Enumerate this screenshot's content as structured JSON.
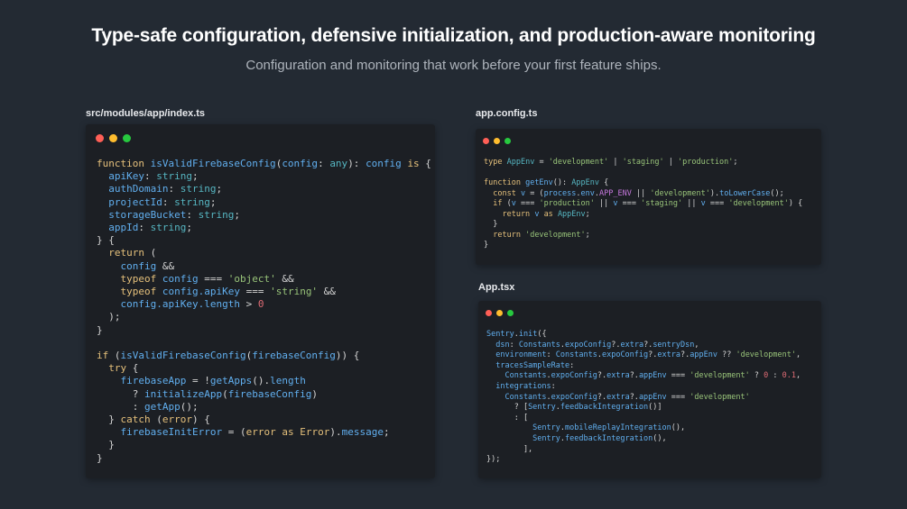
{
  "header": {
    "title": "Type-safe configuration, defensive initialization, and production-aware monitoring",
    "subtitle": "Configuration and monitoring that work before your first feature ships."
  },
  "colors": {
    "background": "#232a33",
    "panel": "#1c1f24",
    "dot_red": "#ff5f56",
    "dot_yellow": "#ffbd2e",
    "dot_green": "#27c93f"
  },
  "panels": [
    {
      "id": "index",
      "filename": "src/modules/app/index.ts",
      "lines": [
        [
          [
            "kw",
            "function "
          ],
          [
            "fn",
            "isValidFirebaseConfig"
          ],
          [
            "op",
            "("
          ],
          [
            "prop",
            "config"
          ],
          [
            "op",
            ": "
          ],
          [
            "ty",
            "any"
          ],
          [
            "op",
            "): "
          ],
          [
            "prop",
            "config"
          ],
          [
            "op",
            " "
          ],
          [
            "kw",
            "is"
          ],
          [
            "op",
            " {"
          ]
        ],
        [
          [
            "prop",
            "  apiKey"
          ],
          [
            "op",
            ": "
          ],
          [
            "ty",
            "string"
          ],
          [
            "op",
            ";"
          ]
        ],
        [
          [
            "prop",
            "  authDomain"
          ],
          [
            "op",
            ": "
          ],
          [
            "ty",
            "string"
          ],
          [
            "op",
            ";"
          ]
        ],
        [
          [
            "prop",
            "  projectId"
          ],
          [
            "op",
            ": "
          ],
          [
            "ty",
            "string"
          ],
          [
            "op",
            ";"
          ]
        ],
        [
          [
            "prop",
            "  storageBucket"
          ],
          [
            "op",
            ": "
          ],
          [
            "ty",
            "string"
          ],
          [
            "op",
            ";"
          ]
        ],
        [
          [
            "prop",
            "  appId"
          ],
          [
            "op",
            ": "
          ],
          [
            "ty",
            "string"
          ],
          [
            "op",
            ";"
          ]
        ],
        [
          [
            "op",
            "} {"
          ]
        ],
        [
          [
            "kw",
            "  return"
          ],
          [
            "op",
            " ("
          ]
        ],
        [
          [
            "prop",
            "    config"
          ],
          [
            "op",
            " &&"
          ]
        ],
        [
          [
            "kw",
            "    typeof"
          ],
          [
            "op",
            " "
          ],
          [
            "prop",
            "config"
          ],
          [
            "op",
            " === "
          ],
          [
            "str",
            "'object'"
          ],
          [
            "op",
            " &&"
          ]
        ],
        [
          [
            "kw",
            "    typeof"
          ],
          [
            "op",
            " "
          ],
          [
            "prop",
            "config.apiKey"
          ],
          [
            "op",
            " === "
          ],
          [
            "str",
            "'string'"
          ],
          [
            "op",
            " &&"
          ]
        ],
        [
          [
            "prop",
            "    config.apiKey.length"
          ],
          [
            "op",
            " > "
          ],
          [
            "num",
            "0"
          ]
        ],
        [
          [
            "op",
            "  );"
          ]
        ],
        [
          [
            "op",
            "}"
          ]
        ],
        [
          [
            "op",
            ""
          ]
        ],
        [
          [
            "kw",
            "if"
          ],
          [
            "op",
            " ("
          ],
          [
            "fn",
            "isValidFirebaseConfig"
          ],
          [
            "op",
            "("
          ],
          [
            "prop",
            "firebaseConfig"
          ],
          [
            "op",
            ")) {"
          ]
        ],
        [
          [
            "kw",
            "  try"
          ],
          [
            "op",
            " {"
          ]
        ],
        [
          [
            "prop",
            "    firebaseApp"
          ],
          [
            "op",
            " = !"
          ],
          [
            "fn",
            "getApps"
          ],
          [
            "op",
            "()."
          ],
          [
            "prop",
            "length"
          ]
        ],
        [
          [
            "op",
            "      ? "
          ],
          [
            "fn",
            "initializeApp"
          ],
          [
            "op",
            "("
          ],
          [
            "prop",
            "firebaseConfig"
          ],
          [
            "op",
            ")"
          ]
        ],
        [
          [
            "op",
            "      : "
          ],
          [
            "fn",
            "getApp"
          ],
          [
            "op",
            "();"
          ]
        ],
        [
          [
            "op",
            "  } "
          ],
          [
            "kw",
            "catch"
          ],
          [
            "op",
            " ("
          ],
          [
            "kw",
            "error"
          ],
          [
            "op",
            ") {"
          ]
        ],
        [
          [
            "prop",
            "    firebaseInitError"
          ],
          [
            "op",
            " = ("
          ],
          [
            "kw",
            "error"
          ],
          [
            "op",
            " "
          ],
          [
            "kw",
            "as"
          ],
          [
            "op",
            " "
          ],
          [
            "kw",
            "Error"
          ],
          [
            "op",
            ")."
          ],
          [
            "prop",
            "message"
          ],
          [
            "op",
            ";"
          ]
        ],
        [
          [
            "op",
            "  }"
          ]
        ],
        [
          [
            "op",
            "}"
          ]
        ]
      ]
    },
    {
      "id": "appconfig",
      "filename": "app.config.ts",
      "lines": [
        [
          [
            "kw",
            "type"
          ],
          [
            "op",
            " "
          ],
          [
            "ty",
            "AppEnv"
          ],
          [
            "op",
            " = "
          ],
          [
            "str",
            "'development'"
          ],
          [
            "op",
            " | "
          ],
          [
            "str",
            "'staging'"
          ],
          [
            "op",
            " | "
          ],
          [
            "str",
            "'production'"
          ],
          [
            "op",
            ";"
          ]
        ],
        [
          [
            "op",
            ""
          ]
        ],
        [
          [
            "kw",
            "function"
          ],
          [
            "op",
            " "
          ],
          [
            "fn",
            "getEnv"
          ],
          [
            "op",
            "(): "
          ],
          [
            "ty",
            "AppEnv"
          ],
          [
            "op",
            " {"
          ]
        ],
        [
          [
            "kw",
            "  const"
          ],
          [
            "op",
            " "
          ],
          [
            "prop",
            "v"
          ],
          [
            "op",
            " = ("
          ],
          [
            "prop",
            "process"
          ],
          [
            "op",
            "."
          ],
          [
            "prop",
            "env"
          ],
          [
            "op",
            "."
          ],
          [
            "var",
            "APP_ENV"
          ],
          [
            "op",
            " || "
          ],
          [
            "str",
            "'development'"
          ],
          [
            "op",
            ")."
          ],
          [
            "fn",
            "toLowerCase"
          ],
          [
            "op",
            "();"
          ]
        ],
        [
          [
            "kw",
            "  if"
          ],
          [
            "op",
            " ("
          ],
          [
            "prop",
            "v"
          ],
          [
            "op",
            " === "
          ],
          [
            "str",
            "'production'"
          ],
          [
            "op",
            " || "
          ],
          [
            "prop",
            "v"
          ],
          [
            "op",
            " === "
          ],
          [
            "str",
            "'staging'"
          ],
          [
            "op",
            " || "
          ],
          [
            "prop",
            "v"
          ],
          [
            "op",
            " === "
          ],
          [
            "str",
            "'development'"
          ],
          [
            "op",
            ") {"
          ]
        ],
        [
          [
            "kw",
            "    return"
          ],
          [
            "op",
            " "
          ],
          [
            "prop",
            "v"
          ],
          [
            "op",
            " "
          ],
          [
            "kw",
            "as"
          ],
          [
            "op",
            " "
          ],
          [
            "ty",
            "AppEnv"
          ],
          [
            "op",
            ";"
          ]
        ],
        [
          [
            "op",
            "  }"
          ]
        ],
        [
          [
            "kw",
            "  return"
          ],
          [
            "op",
            " "
          ],
          [
            "str",
            "'development'"
          ],
          [
            "op",
            ";"
          ]
        ],
        [
          [
            "op",
            "}"
          ]
        ]
      ]
    },
    {
      "id": "apptsx",
      "filename": "App.tsx",
      "lines": [
        [
          [
            "fn",
            "Sentry"
          ],
          [
            "op",
            "."
          ],
          [
            "fn",
            "init"
          ],
          [
            "op",
            "({"
          ]
        ],
        [
          [
            "prop",
            "  dsn"
          ],
          [
            "op",
            ": "
          ],
          [
            "fn",
            "Constants"
          ],
          [
            "op",
            "."
          ],
          [
            "prop",
            "expoConfig"
          ],
          [
            "op",
            "?."
          ],
          [
            "prop",
            "extra"
          ],
          [
            "op",
            "?."
          ],
          [
            "prop",
            "sentryDsn"
          ],
          [
            "op",
            ","
          ]
        ],
        [
          [
            "prop",
            "  environment"
          ],
          [
            "op",
            ": "
          ],
          [
            "fn",
            "Constants"
          ],
          [
            "op",
            "."
          ],
          [
            "prop",
            "expoConfig"
          ],
          [
            "op",
            "?."
          ],
          [
            "prop",
            "extra"
          ],
          [
            "op",
            "?."
          ],
          [
            "prop",
            "appEnv"
          ],
          [
            "op",
            " ?? "
          ],
          [
            "str",
            "'development'"
          ],
          [
            "op",
            ","
          ]
        ],
        [
          [
            "prop",
            "  tracesSampleRate"
          ],
          [
            "op",
            ":"
          ]
        ],
        [
          [
            "fn",
            "    Constants"
          ],
          [
            "op",
            "."
          ],
          [
            "prop",
            "expoConfig"
          ],
          [
            "op",
            "?."
          ],
          [
            "prop",
            "extra"
          ],
          [
            "op",
            "?."
          ],
          [
            "prop",
            "appEnv"
          ],
          [
            "op",
            " === "
          ],
          [
            "str",
            "'development'"
          ],
          [
            "op",
            " ? "
          ],
          [
            "num",
            "0"
          ],
          [
            "op",
            " : "
          ],
          [
            "num",
            "0.1"
          ],
          [
            "op",
            ","
          ]
        ],
        [
          [
            "prop",
            "  integrations"
          ],
          [
            "op",
            ":"
          ]
        ],
        [
          [
            "fn",
            "    Constants"
          ],
          [
            "op",
            "."
          ],
          [
            "prop",
            "expoConfig"
          ],
          [
            "op",
            "?."
          ],
          [
            "prop",
            "extra"
          ],
          [
            "op",
            "?."
          ],
          [
            "prop",
            "appEnv"
          ],
          [
            "op",
            " === "
          ],
          [
            "str",
            "'development'"
          ]
        ],
        [
          [
            "op",
            "      ? ["
          ],
          [
            "fn",
            "Sentry"
          ],
          [
            "op",
            "."
          ],
          [
            "fn",
            "feedbackIntegration"
          ],
          [
            "op",
            "()]"
          ]
        ],
        [
          [
            "op",
            "      : ["
          ]
        ],
        [
          [
            "fn",
            "          Sentry"
          ],
          [
            "op",
            "."
          ],
          [
            "fn",
            "mobileReplayIntegration"
          ],
          [
            "op",
            "(),"
          ]
        ],
        [
          [
            "fn",
            "          Sentry"
          ],
          [
            "op",
            "."
          ],
          [
            "fn",
            "feedbackIntegration"
          ],
          [
            "op",
            "(),"
          ]
        ],
        [
          [
            "op",
            "        ],"
          ]
        ],
        [
          [
            "op",
            "});"
          ]
        ]
      ]
    }
  ]
}
